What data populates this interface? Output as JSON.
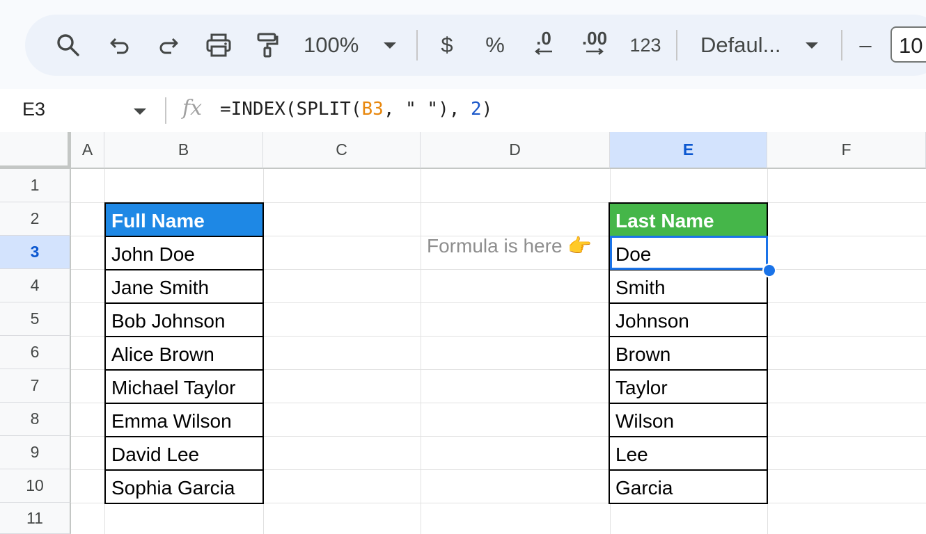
{
  "toolbar": {
    "zoom": "100%",
    "currency_label": "$",
    "percent_label": "%",
    "decrease_decimal_label": ".0",
    "increase_decimal_label": ".00",
    "format_more_label": "123",
    "font_name": "Defaul...",
    "minus_label": "–",
    "font_size": "10",
    "icons": [
      "search-icon",
      "undo-icon",
      "redo-icon",
      "print-icon",
      "paint-format-icon",
      "chevron-down-icon",
      "arrow-left-icon",
      "arrow-right-icon"
    ]
  },
  "formula_bar": {
    "name_box": "E3",
    "fx_label": "fx",
    "formula_prefix": "=INDEX(SPLIT(",
    "formula_ref": "B3",
    "formula_mid": ", \" \"), ",
    "formula_num": "2",
    "formula_suffix": ")"
  },
  "columns": [
    "A",
    "B",
    "C",
    "D",
    "E",
    "F"
  ],
  "rows": [
    "1",
    "2",
    "3",
    "4",
    "5",
    "6",
    "7",
    "8",
    "9",
    "10",
    "11"
  ],
  "selected_cell": "E3",
  "sheet": {
    "full_name_header": "Full Name",
    "last_name_header": "Last Name",
    "note": "Formula is here 👉",
    "full_names": [
      "John Doe",
      "Jane Smith",
      "Bob Johnson",
      "Alice Brown",
      "Michael Taylor",
      "Emma Wilson",
      "David Lee",
      "Sophia Garcia"
    ],
    "last_names": [
      "Doe",
      "Smith",
      "Johnson",
      "Brown",
      "Taylor",
      "Wilson",
      "Lee",
      "Garcia"
    ]
  },
  "colors": {
    "header_blue": "#1e88e5",
    "header_green": "#45b649",
    "selection": "#1a73e8",
    "ref_orange": "#e8870d",
    "num_blue": "#1a57c9"
  }
}
